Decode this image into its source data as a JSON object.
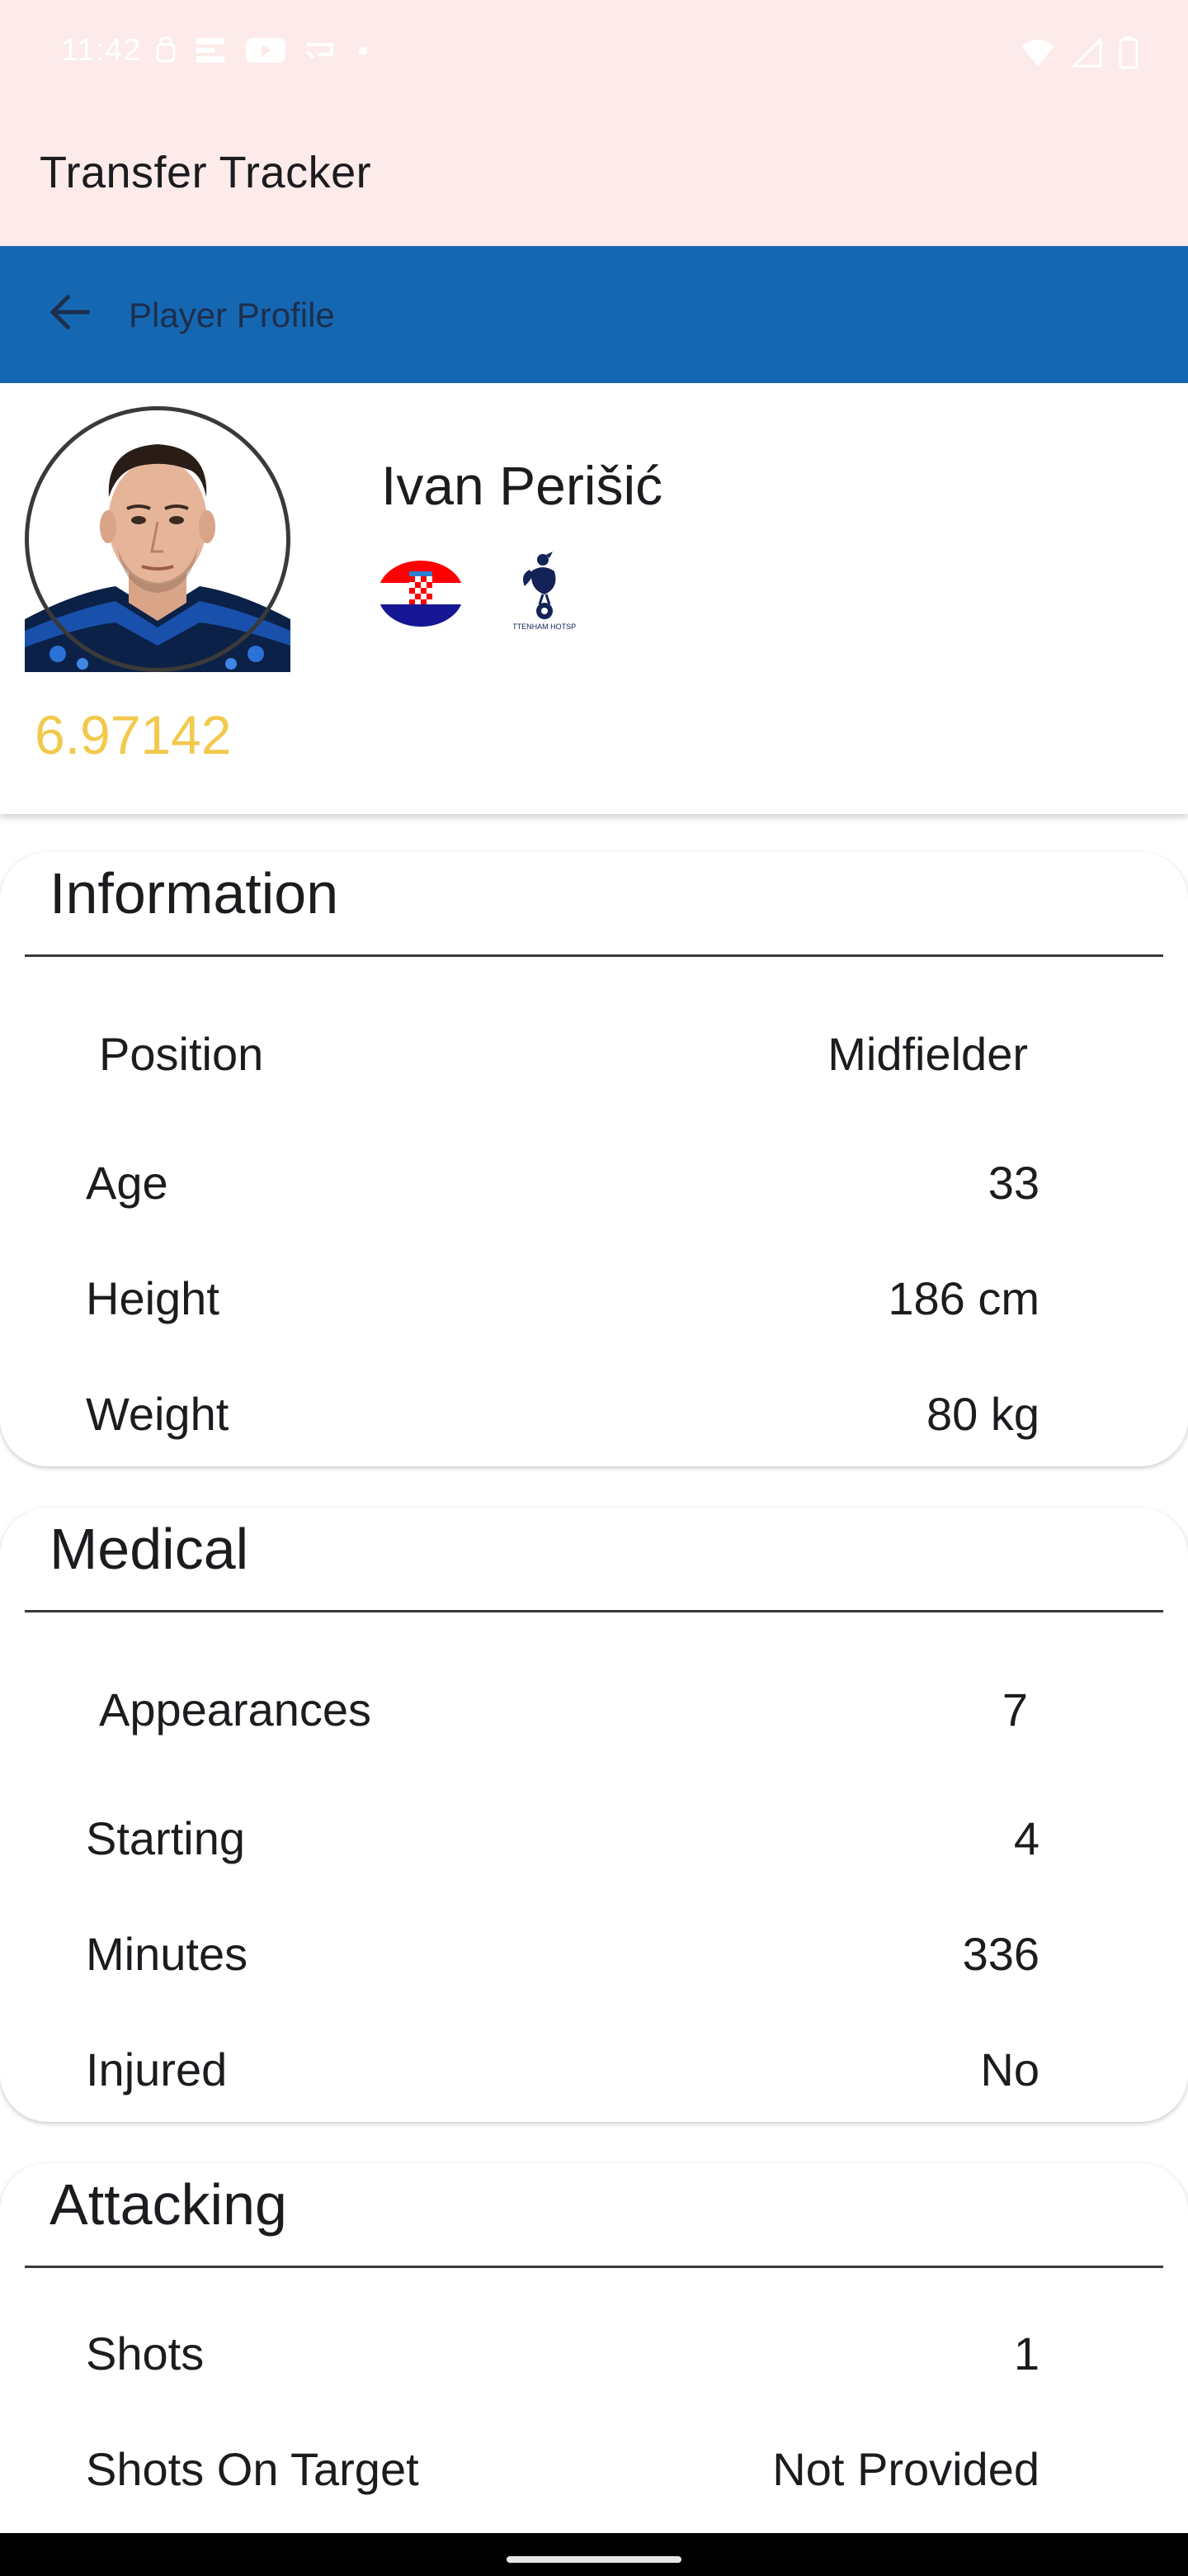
{
  "status_bar": {
    "time": "11:42"
  },
  "app_bar": {
    "title": "Transfer Tracker"
  },
  "sub_bar": {
    "title": "Player Profile",
    "back_icon": "arrow-back-icon"
  },
  "player": {
    "name": "Ivan Perišić",
    "rating": "6.97142",
    "flag_icon": "croatia-flag-icon",
    "club_icon": "tottenham-hotspur-crest-icon",
    "club_crest_text": "TOTTENHAM HOTSPUR"
  },
  "sections": {
    "information": {
      "title": "Information",
      "rows": [
        {
          "label": "Position",
          "value": "Midfielder"
        },
        {
          "label": "Age",
          "value": "33"
        },
        {
          "label": "Height",
          "value": "186 cm"
        },
        {
          "label": "Weight",
          "value": "80 kg"
        }
      ]
    },
    "medical": {
      "title": "Medical",
      "rows": [
        {
          "label": "Appearances",
          "value": "7"
        },
        {
          "label": "Starting",
          "value": "4"
        },
        {
          "label": "Minutes",
          "value": "336"
        },
        {
          "label": "Injured",
          "value": "No"
        }
      ]
    },
    "attacking": {
      "title": "Attacking",
      "rows": [
        {
          "label": "Shots",
          "value": "1"
        },
        {
          "label": "Shots On Target",
          "value": "Not Provided"
        }
      ]
    }
  },
  "colors": {
    "app_bar_bg": "#fcebea",
    "sub_bar_bg": "#1667b1",
    "rating": "#f2c94c",
    "text": "#1c1b1f"
  }
}
